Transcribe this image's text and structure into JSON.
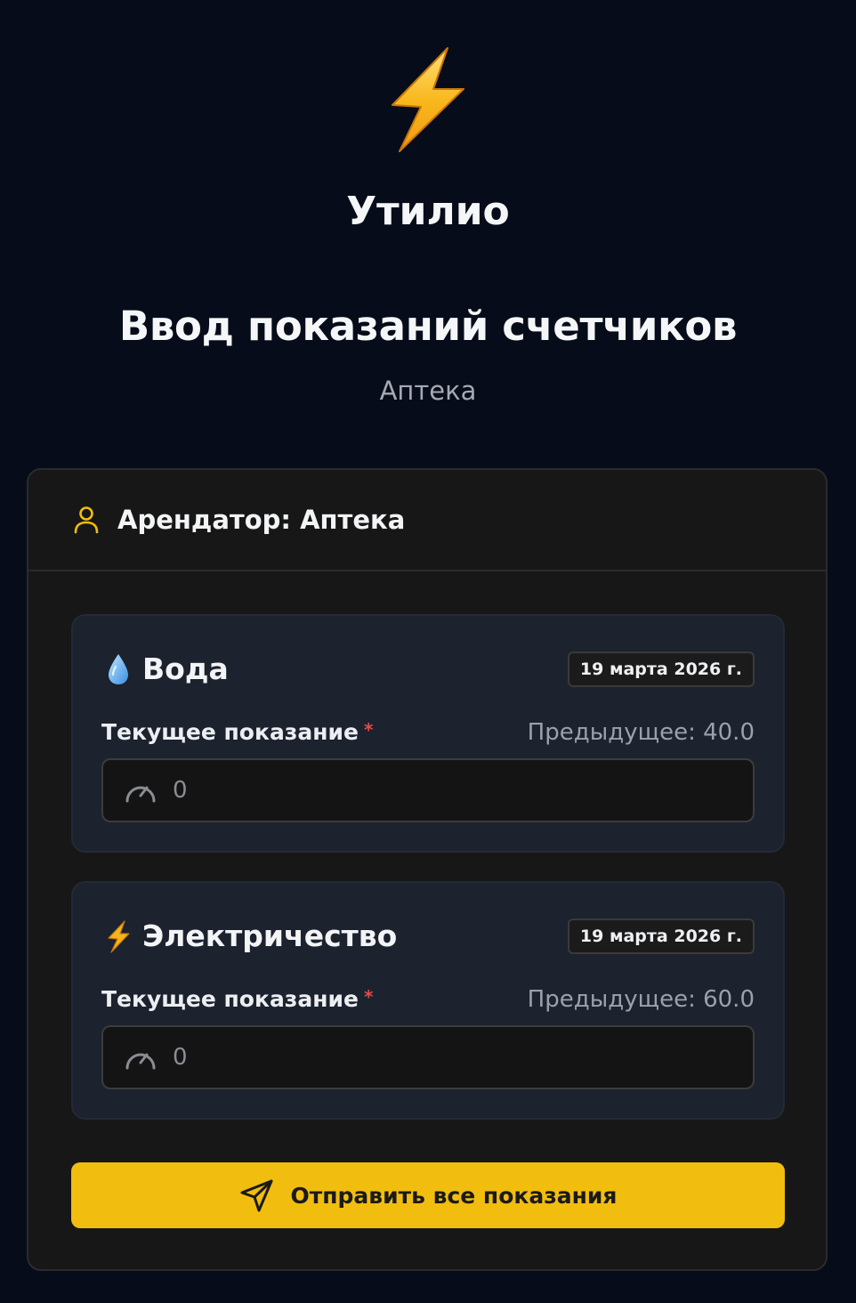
{
  "app": {
    "logo_icon": "lightning-bolt-icon",
    "brand": "Утилио",
    "title": "Ввод показаний счетчиков",
    "subtitle": "Аптека"
  },
  "card": {
    "tenant_icon": "user-icon",
    "tenant_title": "Арендатор: Аптека",
    "meters": [
      {
        "icon": "water-drop-icon",
        "name": "Вода",
        "date": "19 марта 2026 г.",
        "label": "Текущее показание",
        "required_mark": "*",
        "previous": "Предыдущее: 40.0",
        "placeholder": "0",
        "value": ""
      },
      {
        "icon": "lightning-icon",
        "name": "Электричество",
        "date": "19 марта 2026 г.",
        "label": "Текущее показание",
        "required_mark": "*",
        "previous": "Предыдущее: 60.0",
        "placeholder": "0",
        "value": ""
      }
    ],
    "submit_label": "Отправить все показания",
    "submit_icon": "send-icon"
  },
  "colors": {
    "background": "#070c1a",
    "card": "#171717",
    "meter_card": "#1c222e",
    "accent": "#f1bd0f",
    "required": "#e34b4b"
  }
}
